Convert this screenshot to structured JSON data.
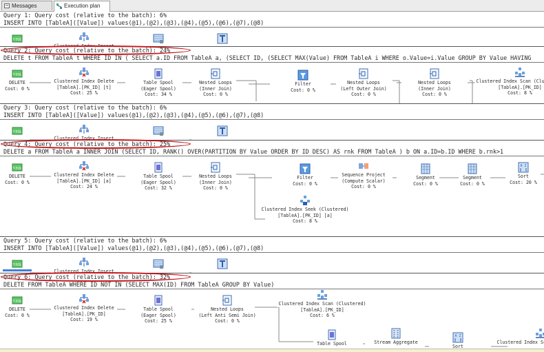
{
  "tabs": [
    {
      "label": "Messages",
      "icon": "messages-icon"
    },
    {
      "label": "Execution plan",
      "icon": "execution-plan-icon",
      "active": true
    }
  ],
  "queries": [
    {
      "header": "Query 1: Query cost (relative to the batch): 6%",
      "sql": "INSERT INTO [TableA]([Value]) values(@1),(@2),(@3),(@4),(@5),(@6),(@7),(@8)",
      "highlighted": false,
      "nodes": [
        {
          "icon": "tsql-icon",
          "lines": []
        },
        {
          "icon": "clustered-index-insert-icon",
          "lines": [
            "Clustered Index Insert"
          ]
        },
        {
          "icon": "table-scan-icon",
          "lines": []
        },
        {
          "icon": "constant-scan-icon",
          "lines": []
        }
      ]
    },
    {
      "header": "Query 2: Query cost (relative to the batch): 24%",
      "sql": "DELETE t FROM TableA t WHERE ID IN ( SELECT a.ID FROM TableA a, (SELECT ID, (SELECT MAX(Value) FROM TableA i WHERE o.Value=i.Value GROUP BY Value HAVING",
      "highlighted": true,
      "nodes": [
        {
          "icon": "tsql-icon",
          "lines": [
            "DELETE",
            "Cost: 0 %"
          ]
        },
        {
          "icon": "clustered-index-delete-icon",
          "lines": [
            "Clustered Index Delete",
            "[TableA].[PK_ID] [t]",
            "Cost: 25 %"
          ]
        },
        {
          "icon": "table-spool-icon",
          "lines": [
            "Table Spool",
            "(Eager Spool)",
            "Cost: 34 %"
          ]
        },
        {
          "icon": "nested-loops-icon",
          "lines": [
            "Nested Loops",
            "(Inner Join)",
            "Cost: 0 %"
          ]
        },
        {
          "icon": "filter-icon",
          "lines": [
            "Filter",
            "Cost: 0 %"
          ]
        },
        {
          "icon": "nested-loops-icon",
          "lines": [
            "Nested Loops",
            "(Left Outer Join)",
            "Cost: 0 %"
          ]
        },
        {
          "icon": "nested-loops-icon",
          "lines": [
            "Nested Loops",
            "(Inner Join)",
            "Cost: 0 %"
          ]
        },
        {
          "icon": "clustered-index-scan-icon",
          "lines": [
            "Clustered Index Scan (Clustered)",
            "[TableA].[PK_ID]",
            "Cost: 8 %"
          ]
        }
      ]
    },
    {
      "header": "Query 3: Query cost (relative to the batch): 6%",
      "sql": "INSERT INTO [TableA]([Value]) values(@1),(@2),(@3),(@4),(@5),(@6),(@7),(@8)",
      "highlighted": false,
      "nodes": [
        {
          "icon": "tsql-icon",
          "lines": []
        },
        {
          "icon": "clustered-index-insert-icon",
          "lines": [
            "Clustered Index Insert"
          ]
        },
        {
          "icon": "table-scan-icon",
          "lines": []
        },
        {
          "icon": "constant-scan-icon",
          "lines": []
        }
      ]
    },
    {
      "header": "Query 4: Query cost (relative to the batch): 25%",
      "sql": "DELETE a FROM TableA a INNER JOIN (SELECT ID, RANK() OVER(PARTITION BY Value ORDER BY ID DESC) AS rnk FROM TableA ) b ON a.ID=b.ID WHERE b.rnk>1",
      "highlighted": true,
      "nodes": [
        {
          "icon": "tsql-icon",
          "lines": [
            "DELETE",
            "Cost: 0 %"
          ]
        },
        {
          "icon": "clustered-index-delete-icon",
          "lines": [
            "Clustered Index Delete",
            "[TableA].[PK_ID] [a]",
            "Cost: 24 %"
          ]
        },
        {
          "icon": "table-spool-icon",
          "lines": [
            "Table Spool",
            "(Eager Spool)",
            "Cost: 32 %"
          ]
        },
        {
          "icon": "nested-loops-icon",
          "lines": [
            "Nested Loops",
            "(Inner Join)",
            "Cost: 0 %"
          ]
        },
        {
          "icon": "filter-icon",
          "lines": [
            "Filter",
            "Cost: 0 %"
          ]
        },
        {
          "icon": "sequence-project-icon",
          "lines": [
            "Sequence Project",
            "(Compute Scalar)",
            "Cost: 0 %"
          ]
        },
        {
          "icon": "segment-icon",
          "lines": [
            "Segment",
            "Cost: 0 %"
          ]
        },
        {
          "icon": "segment-icon",
          "lines": [
            "Segment",
            "Cost: 0 %"
          ]
        },
        {
          "icon": "sort-icon",
          "lines": [
            "Sort",
            "Cost: 20 %"
          ]
        },
        {
          "icon": "clustered-index-seek-icon",
          "lines": [
            "Clustered Index Seek (Clustered)",
            "[TableA].[PK_ID] [a]",
            "Cost: 8 %"
          ]
        }
      ]
    },
    {
      "header": "Query 5: Query cost (relative to the batch): 6%",
      "sql": "INSERT INTO [TableA]([Value]) values(@1),(@2),(@3),(@4),(@5),(@6),(@7),(@8)",
      "highlighted": false,
      "nodes": [
        {
          "icon": "tsql-icon",
          "lines": []
        },
        {
          "icon": "clustered-index-insert-icon",
          "lines": [
            "Clustered Index Insert"
          ]
        },
        {
          "icon": "table-scan-icon",
          "lines": []
        },
        {
          "icon": "constant-scan-icon",
          "lines": []
        }
      ]
    },
    {
      "header": "Query 6: Query cost (relative to the batch): 32%",
      "sql": "DELETE FROM TableA WHERE ID NOT IN (SELECT MAX(ID) FROM TableA GROUP BY Value)",
      "highlighted": true,
      "nodes": [
        {
          "icon": "tsql-icon",
          "lines": [
            "DELETE",
            "Cost: 0 %"
          ]
        },
        {
          "icon": "clustered-index-delete-icon",
          "lines": [
            "Clustered Index Delete",
            "[TableA].[PK_ID]",
            "Cost: 19 %"
          ]
        },
        {
          "icon": "table-spool-icon",
          "lines": [
            "Table Spool",
            "(Eager Spool)",
            "Cost: 25 %"
          ]
        },
        {
          "icon": "nested-loops-icon",
          "lines": [
            "Nested Loops",
            "(Left Anti Semi Join)",
            "Cost: 0 %"
          ]
        },
        {
          "icon": "clustered-index-scan-icon",
          "lines": [
            "Clustered Index Scan (Clustered)",
            "[TableA].[PK_ID]",
            "Cost: 6 %"
          ]
        },
        {
          "icon": "table-spool-icon",
          "lines": [
            "Table Spool"
          ]
        },
        {
          "icon": "stream-aggregate-icon",
          "lines": [
            "Stream Aggregate"
          ]
        },
        {
          "icon": "sort-icon",
          "lines": [
            "Sort"
          ]
        },
        {
          "icon": "clustered-index-scan-icon",
          "lines": [
            "Clustered Index Scan (Clustered)"
          ]
        }
      ]
    }
  ]
}
